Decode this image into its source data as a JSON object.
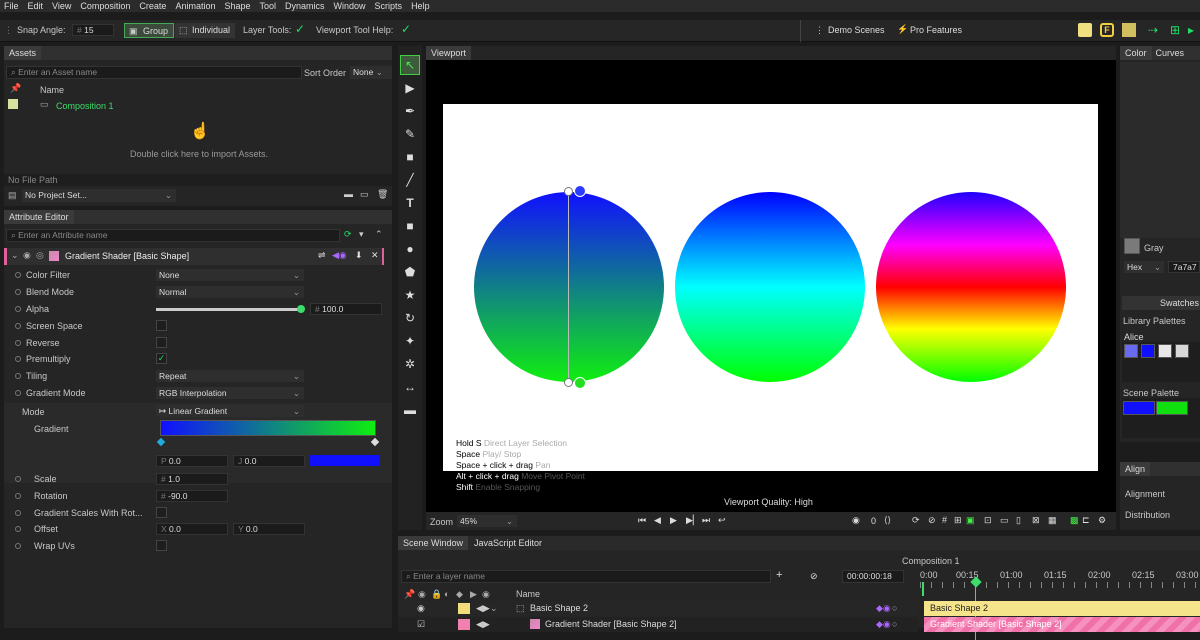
{
  "menu": [
    "File",
    "Edit",
    "View",
    "Composition",
    "Create",
    "Animation",
    "Shape",
    "Tool",
    "Dynamics",
    "Window",
    "Scripts",
    "Help"
  ],
  "toolbar": {
    "snap_angle_label": "Snap Angle:",
    "snap_angle_value": "15",
    "group_label": "Group",
    "individual_label": "Individual",
    "layer_tools_label": "Layer Tools:",
    "viewport_help_label": "Viewport Tool Help:",
    "demo_scenes": "Demo Scenes",
    "pro_features": "Pro Features"
  },
  "assets": {
    "tab": "Assets",
    "search_placeholder": "Enter an Asset name",
    "sort_label": "Sort Order",
    "sort_value": "None",
    "col_name": "Name",
    "item": "Composition 1",
    "import_hint": "Double click here to import Assets.",
    "file_path": "No File Path",
    "project_set": "No Project Set..."
  },
  "attr": {
    "tab": "Attribute Editor",
    "search_placeholder": "Enter an Attribute name",
    "layer": "Gradient Shader [Basic Shape]",
    "rows": [
      {
        "label": "Color Filter",
        "value": "None"
      },
      {
        "label": "Blend Mode",
        "value": "Normal"
      },
      {
        "label": "Alpha",
        "value": "100.0"
      },
      {
        "label": "Screen Space",
        "value": ""
      },
      {
        "label": "Reverse",
        "value": ""
      },
      {
        "label": "Premultiply",
        "value": "✓"
      },
      {
        "label": "Tiling",
        "value": "Repeat"
      },
      {
        "label": "Gradient Mode",
        "value": "RGB Interpolation"
      }
    ],
    "mode_label": "Mode",
    "mode_value": "↦ Linear Gradient",
    "gradient_label": "Gradient",
    "p_label": "P",
    "p_value": "0.0",
    "j_label": "J",
    "j_value": "0.0",
    "scale_label": "Scale",
    "scale_value": "1.0",
    "rotation_label": "Rotation",
    "rotation_value": "-90.0",
    "gsr_label": "Gradient Scales With Rot...",
    "offset_label": "Offset",
    "offset_x_label": "X",
    "offset_x": "0.0",
    "offset_y_label": "Y",
    "offset_y": "0.0",
    "wrap_label": "Wrap UVs",
    "hash": "#"
  },
  "viewport": {
    "tab": "Viewport",
    "quality": "Viewport Quality: High",
    "zoom_label": "Zoom",
    "zoom_value": "45%",
    "hints": [
      {
        "key": "Hold S",
        "desc": "Direct Layer Selection"
      },
      {
        "key": "Space",
        "desc": "Play/ Stop"
      },
      {
        "key": "Space + click + drag",
        "desc": "Pan"
      },
      {
        "key": "Alt + click + drag",
        "desc": "Move Pivot Point"
      },
      {
        "key": "Shift",
        "desc": "Enable Snapping"
      }
    ],
    "frame_value": "0"
  },
  "right": {
    "tab_color": "Color",
    "tab_curves": "Curves",
    "gray_label": "Gray",
    "hex_label": "Hex",
    "hex_value": "7a7a7",
    "swatches_btn": "Swatches",
    "library_palettes": "Library Palettes",
    "palette_name": "Alice",
    "scene_palette": "Scene Palette",
    "align_tab": "Align",
    "alignment": "Alignment",
    "distribution": "Distribution",
    "alice_colors": [
      "#6a6af0",
      "#1010ff",
      "#e8e8e8",
      "#d8d8d8"
    ],
    "scene_colors": [
      "#1010ff",
      "#10e010"
    ]
  },
  "timeline": {
    "tab_scene": "Scene Window",
    "tab_js": "JavaScript Editor",
    "comp": "Composition 1",
    "search_placeholder": "Enter a layer name",
    "time": "00:00:00:18",
    "col_name": "Name",
    "ticks": [
      "0:00",
      "00:15",
      "01:00",
      "01:15",
      "02:00",
      "02:15",
      "03:00"
    ],
    "layer1": "Basic Shape 2",
    "layer2": "Gradient Shader [Basic Shape 2]",
    "bar1": "Basic Shape 2",
    "bar2": "Gradient Shader [Basic Shape 2]"
  },
  "colors": {
    "accent_green": "#22dd66",
    "gradient_start": "#1010ff",
    "gradient_end": "#10ee10"
  }
}
